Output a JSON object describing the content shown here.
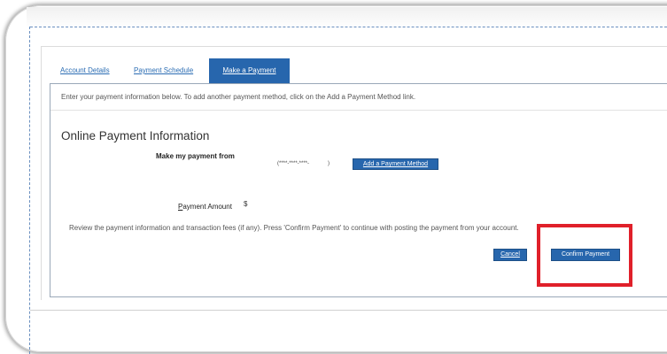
{
  "tabs": [
    {
      "label": "Account Details",
      "active": false
    },
    {
      "label": "Payment Schedule",
      "active": false
    },
    {
      "label": "Make a Payment",
      "active": true
    }
  ],
  "intro_text": "Enter your payment information below. To add another payment method, click on the Add a Payment Method link.",
  "section_title": "Online Payment Information",
  "payment_from": {
    "label": "Make my payment from",
    "masked_account": "(****-****-****-",
    "masked_account_close": ")",
    "add_method_label": "Add a Payment Method"
  },
  "payment_amount": {
    "label_underlined": "P",
    "label_rest": "ayment Amount",
    "currency": "$"
  },
  "review_text": "Review the payment information and transaction fees (if any). Press 'Confirm Payment' to continue with posting the payment from your account.",
  "buttons": {
    "cancel_label": "Cancel",
    "confirm_label": "Confirm Payment"
  },
  "colors": {
    "accent": "#2766ad",
    "link": "#2a6cb3",
    "highlight": "#e0202a"
  }
}
